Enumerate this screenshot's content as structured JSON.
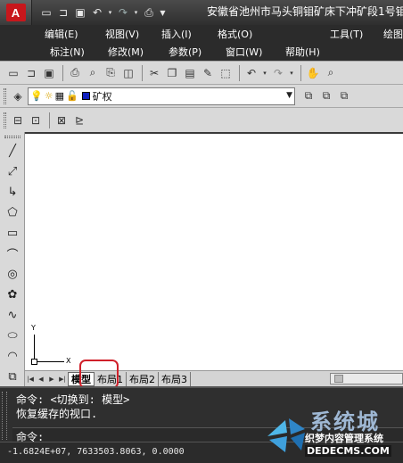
{
  "app": {
    "logo_letter": "A",
    "title": "安徽省池州市马头铜钼矿床下冲矿段1号钼"
  },
  "menu": {
    "row1": [
      "编辑(E)",
      "视图(V)",
      "插入(I)",
      "格式(O)",
      "工具(T)",
      "绘图"
    ],
    "row2": [
      "标注(N)",
      "修改(M)",
      "参数(P)",
      "窗口(W)",
      "帮助(H)"
    ]
  },
  "layer": {
    "name": "矿权",
    "color": "#1020c0"
  },
  "tabs": {
    "model": "模型",
    "layout1": "布局1",
    "layout2": "布局2",
    "layout3": "布局3"
  },
  "ucs": {
    "y": "Y",
    "x": "X"
  },
  "command": {
    "line1": "命令:  <切换到: 模型>",
    "line2": "恢复缓存的视口.",
    "prompt": "命令:"
  },
  "status": {
    "coordinates": "-1.6824E+07,  7633503.8063, 0.0000"
  },
  "watermark": {
    "title": "系统城",
    "subtitle": "织梦内容管理系统",
    "url": "DEDECMS.COM"
  },
  "colors": {
    "highlight": "#d0202a",
    "brand_red": "#c8171c"
  }
}
